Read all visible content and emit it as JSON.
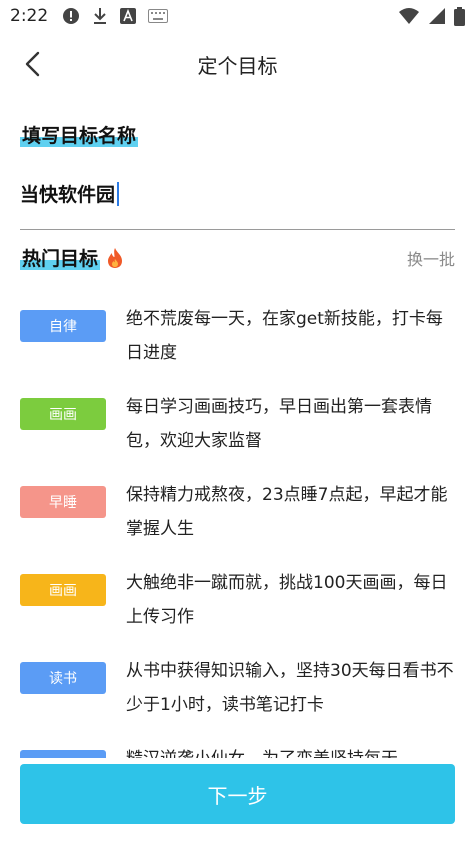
{
  "status": {
    "time": "2:22",
    "left_icons": [
      "alert-icon",
      "download-icon",
      "a-icon",
      "keyboard-icon"
    ],
    "right_icons": [
      "wifi-icon",
      "signal-icon",
      "battery-icon"
    ]
  },
  "nav": {
    "title": "定个目标",
    "back_icon": "chevron-left-icon"
  },
  "name_section": {
    "title": "填写目标名称",
    "value": "当快软件园"
  },
  "hot": {
    "title": "热门目标",
    "icon": "fire-icon",
    "refresh_label": "换一批"
  },
  "goals": [
    {
      "tag": "自律",
      "color": "#5b9cf5",
      "text": "绝不荒废每一天，在家get新技能，打卡每日进度"
    },
    {
      "tag": "画画",
      "color": "#7ccc3e",
      "text": "每日学习画画技巧，早日画出第一套表情包，欢迎大家监督"
    },
    {
      "tag": "早睡",
      "color": "#f5958a",
      "text": "保持精力戒熬夜，23点睡7点起，早起才能掌握人生"
    },
    {
      "tag": "画画",
      "color": "#f7b51a",
      "text": "大触绝非一蹴而就，挑战100天画画，每日上传习作"
    },
    {
      "tag": "读书",
      "color": "#5b9cf5",
      "text": "从书中获得知识输入，坚持30天每日看书不少于1小时，读书笔记打卡"
    },
    {
      "tag": "",
      "color": "#5b9cf5",
      "text": "糙汉逆袭小仙女，为了变美坚持每天"
    }
  ],
  "next_button": {
    "label": "下一步"
  }
}
